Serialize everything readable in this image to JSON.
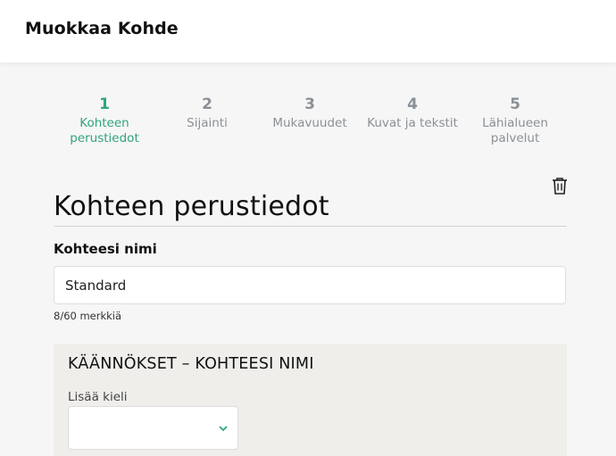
{
  "header": {
    "title": "Muokkaa Kohde"
  },
  "steps": [
    {
      "number": "1",
      "label_line1": "Kohteen",
      "label_line2": "perustiedot",
      "active": true
    },
    {
      "number": "2",
      "label_line1": "Sijainti",
      "label_line2": ""
    },
    {
      "number": "3",
      "label_line1": "Mukavuudet",
      "label_line2": ""
    },
    {
      "number": "4",
      "label_line1": "Kuvat ja tekstit",
      "label_line2": ""
    },
    {
      "number": "5",
      "label_line1": "Lähialueen",
      "label_line2": "palvelut"
    }
  ],
  "section": {
    "title": "Kohteen perustiedot",
    "delete_icon": "trash-icon"
  },
  "name_field": {
    "label": "Kohteesi nimi",
    "value": "Standard",
    "char_count": "8/60 merkkiä"
  },
  "translations": {
    "title": "KÄÄNNÖKSET – KOHTEESI NIMI",
    "add_language_label": "Lisää kieli",
    "select_value": "",
    "chevron_icon": "chevron-down-icon"
  },
  "colors": {
    "accent": "#2fa57a",
    "inactive_step": "#8b9096",
    "page_bg": "#f6f6f6",
    "panel_bg": "#efeeeb"
  }
}
